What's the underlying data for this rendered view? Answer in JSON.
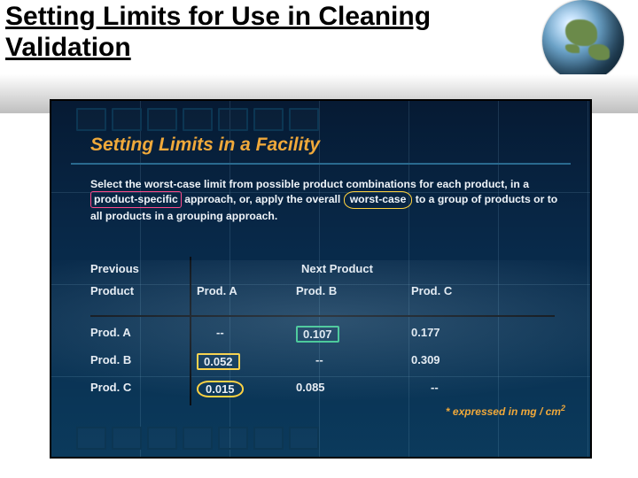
{
  "slide": {
    "title": "Setting Limits for Use in Cleaning Validation"
  },
  "panel": {
    "heading": "Setting Limits in a Facility",
    "paragraph": {
      "p1": "Select the worst-case limit from possible product combinations for each product, in a ",
      "psbox": "product-specific",
      "p2": " approach, or, apply the overall ",
      "wcbox": "worst-case",
      "p3": " to a group of products or to all products in a grouping approach."
    },
    "table": {
      "rowHeader1": "Previous",
      "rowHeader2": "Product",
      "colGroup": "Next Product",
      "cols": [
        "Prod. A",
        "Prod. B",
        "Prod. C"
      ],
      "rows": [
        {
          "label": "Prod. A",
          "a": "--",
          "b": "0.107",
          "c": "0.177"
        },
        {
          "label": "Prod. B",
          "a": "0.052",
          "b": "--",
          "c": "0.309"
        },
        {
          "label": "Prod. C",
          "a": "0.015",
          "b": "0.085",
          "c": "--"
        }
      ]
    },
    "footnote": "* expressed in mg / cm"
  },
  "chart_data": {
    "type": "table",
    "title": "Setting Limits in a Facility — worst-case residue limits (mg/cm²)",
    "row_axis": "Previous Product",
    "col_axis": "Next Product",
    "categories": [
      "Prod. A",
      "Prod. B",
      "Prod. C"
    ],
    "matrix": [
      [
        null,
        0.107,
        0.177
      ],
      [
        0.052,
        null,
        0.309
      ],
      [
        0.015,
        0.085,
        null
      ]
    ],
    "highlights": {
      "product_specific_example": {
        "row": "Prod. A",
        "col": "Prod. B",
        "value": 0.107
      },
      "overall_worst_case": {
        "row": "Prod. C",
        "col": "Prod. A",
        "value": 0.015
      }
    },
    "units": "mg/cm²"
  }
}
